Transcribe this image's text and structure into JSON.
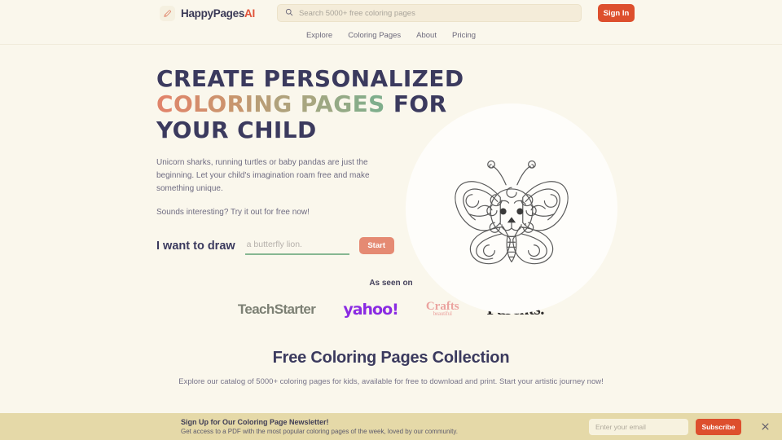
{
  "header": {
    "logo_text_primary": "HappyPages",
    "logo_text_accent": "AI",
    "logo_icon": "pencil-icon",
    "search": {
      "icon": "search-icon",
      "placeholder": "Search 5000+ free coloring pages",
      "value": ""
    },
    "signin_label": "Sign In",
    "nav_items": [
      {
        "label": "Explore"
      },
      {
        "label": "Coloring Pages"
      },
      {
        "label": "About"
      },
      {
        "label": "Pricing"
      }
    ]
  },
  "hero": {
    "headline_lines": [
      {
        "text": "CREATE PERSONALIZED",
        "style": "solid"
      },
      {
        "text": "COLORING PAGES FOR",
        "style": "gradient"
      },
      {
        "text": "YOUR CHILD",
        "style": "solid"
      }
    ],
    "headline_plain": "CREATE PERSONALIZED COLORING PAGES FOR YOUR CHILD",
    "paragraph_1": "Unicorn sharks, running turtles or baby pandas are just the beginning. Let your child's imagination roam free and make something unique.",
    "paragraph_2": "Sounds interesting? Try it out for free now!",
    "draw_label": "I want to draw",
    "draw_placeholder": "a butterfly lion.",
    "draw_value": "",
    "start_label": "Start",
    "illustration": "butterfly-lion-coloring-page"
  },
  "press": {
    "label": "As seen on",
    "logos": [
      {
        "name": "TeachStarter",
        "color": "#7c8074"
      },
      {
        "name": "yahoo!",
        "color": "#8a2be2"
      },
      {
        "name": "Crafts",
        "subname": "beautiful",
        "color": "#eba39f"
      },
      {
        "name": "Parents.",
        "color": "#2f2d2c"
      }
    ]
  },
  "collection": {
    "title": "Free Coloring Pages Collection",
    "subtitle": "Explore our catalog of 5000+ coloring pages for kids, available for free to download and print. Start your artistic journey now!"
  },
  "newsletter": {
    "title": "Sign Up for Our Coloring Page Newsletter!",
    "subtitle": "Get access to a PDF with the most popular coloring pages of the week, loved by our community.",
    "email_placeholder": "Enter your email",
    "email_value": "",
    "subscribe_label": "Subscribe",
    "close_icon": "close-icon"
  },
  "colors": {
    "page_background": "#faf7ec",
    "accent_red": "#dd4f2d",
    "accent_coral": "#e58a73",
    "accent_green": "#86b792",
    "navy": "#3b3a5e",
    "newsletter_background": "#e5d9a8"
  }
}
